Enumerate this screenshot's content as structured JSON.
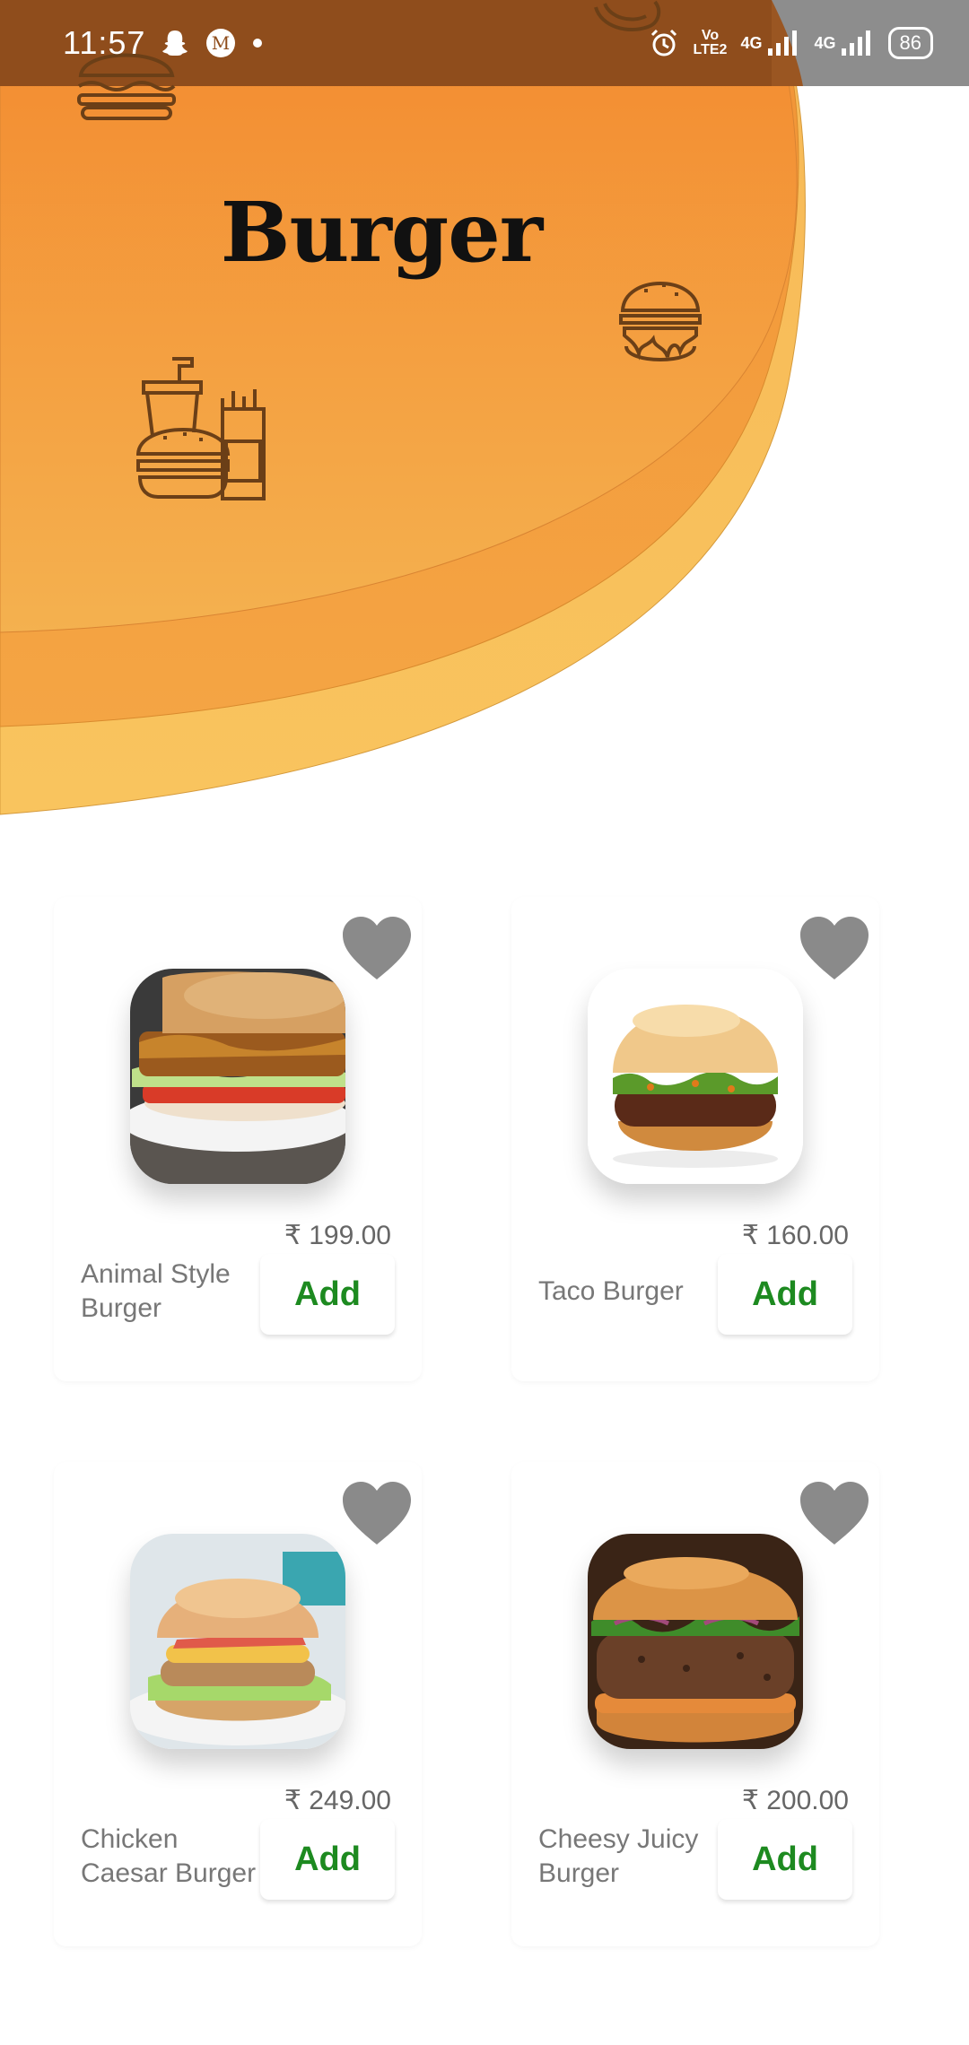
{
  "status_bar": {
    "time": "11:57",
    "battery": "86",
    "network_1": "4G",
    "network_2": "4G",
    "volte": "Vo LTE2",
    "icons": [
      "snapchat-icon",
      "m-app-icon",
      "dot-icon",
      "alarm-icon",
      "signal-icon",
      "signal-icon",
      "battery-icon"
    ]
  },
  "header": {
    "title": "Burger",
    "colors": {
      "orange_top": "#f38a2f",
      "orange_mid": "#f39a3a",
      "orange_bottom": "#f7bb55",
      "brown": "#8f4d1c",
      "icon_brown": "#6b3f17"
    }
  },
  "products": [
    {
      "name": "Animal Style Burger",
      "price": "₹ 199.00",
      "add_label": "Add",
      "image": "animal-style-burger"
    },
    {
      "name": "Taco Burger",
      "price": "₹ 160.00",
      "add_label": "Add",
      "image": "taco-burger"
    },
    {
      "name": "Chicken Caesar Burger",
      "price": "₹ 249.00",
      "add_label": "Add",
      "image": "chicken-caesar-burger"
    },
    {
      "name": "Cheesy Juicy Burger",
      "price": "₹ 200.00",
      "add_label": "Add",
      "image": "cheesy-juicy-burger"
    }
  ],
  "colors": {
    "add_text": "#1d8a20",
    "heart": "#8a8a8a",
    "price": "#666666",
    "name": "#777777"
  }
}
